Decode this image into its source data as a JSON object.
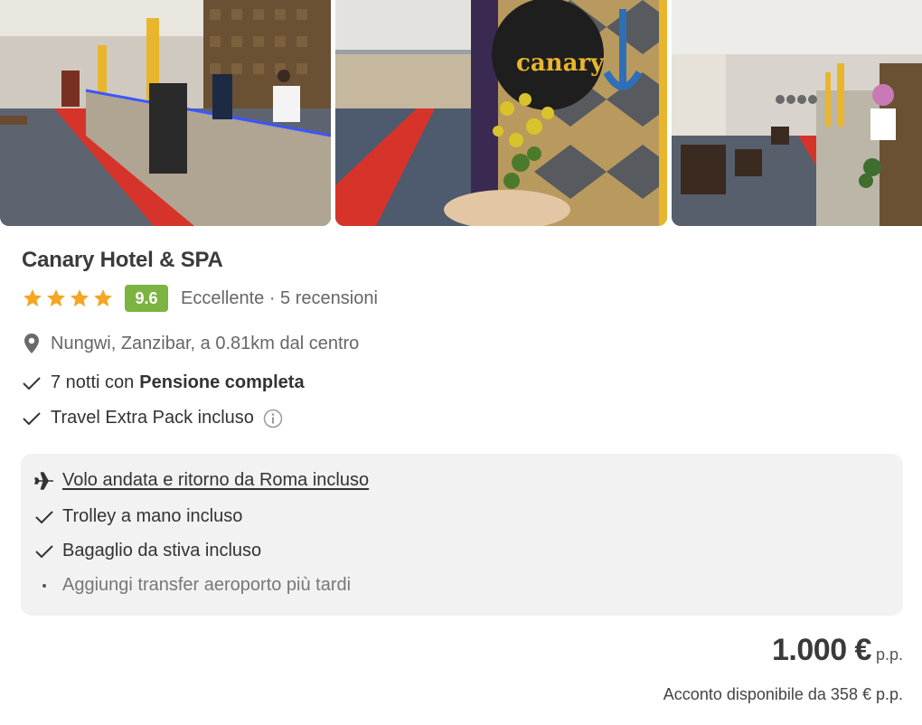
{
  "gallery": {
    "photos": [
      "reception-desk-photo",
      "lobby-corridor-photo",
      "lobby-hall-photo"
    ],
    "logo_text": "canary"
  },
  "hotel": {
    "name": "Canary Hotel & SPA",
    "stars": 4,
    "score": "9.6",
    "rating_text": "Eccellente · 5 recensioni",
    "location": "Nungwi, Zanzibar, a 0.81km dal centro"
  },
  "features": {
    "nights_prefix": "7 notti con",
    "board": "Pensione completa",
    "extra_pack": "Travel Extra Pack incluso"
  },
  "flight": {
    "title": "Volo andata e ritorno da Roma incluso",
    "trolley": "Trolley a mano incluso",
    "hold_bag": "Bagaglio da stiva incluso",
    "transfer": "Aggiungi transfer aeroporto più tardi"
  },
  "pricing": {
    "price": "1.000 €",
    "unit": "p.p.",
    "deposit": "Acconto disponibile da 358 € p.p."
  },
  "colors": {
    "star": "#f5a623",
    "score_badge": "#7cb342",
    "box_bg": "#f2f2f2",
    "carpet": "#d6342a"
  }
}
